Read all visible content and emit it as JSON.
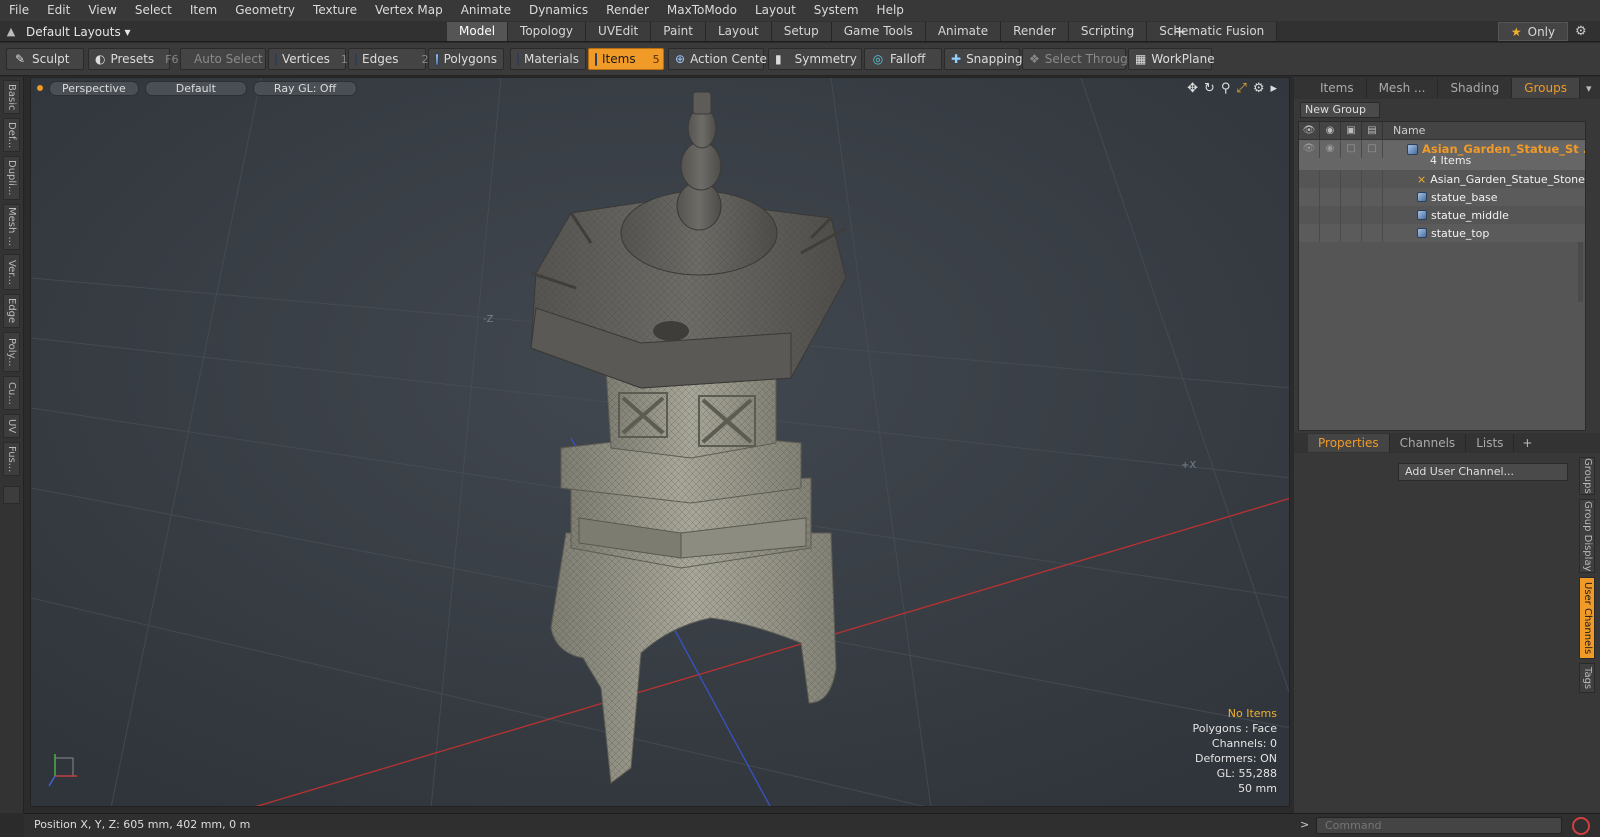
{
  "menu": [
    "File",
    "Edit",
    "View",
    "Select",
    "Item",
    "Geometry",
    "Texture",
    "Vertex Map",
    "Animate",
    "Dynamics",
    "Render",
    "MaxToModo",
    "Layout",
    "System",
    "Help"
  ],
  "layouts": {
    "label": "Default Layouts ▾"
  },
  "mode_tabs": [
    "Model",
    "Topology",
    "UVEdit",
    "Paint",
    "Layout",
    "Setup",
    "Game Tools",
    "Animate",
    "Render",
    "Scripting",
    "Schematic Fusion"
  ],
  "active_mode_tab": "Model",
  "only_label": "Only",
  "toolbar": {
    "sculpt": "Sculpt",
    "presets": "Presets",
    "presets_key": "F6",
    "auto_select": "Auto Select",
    "vertices": "Vertices",
    "vertices_key": "1",
    "edges": "Edges",
    "edges_key": "2",
    "polygons": "Polygons",
    "materials": "Materials",
    "items": "Items",
    "items_key": "5",
    "action_center": "Action Center",
    "symmetry": "Symmetry",
    "falloff": "Falloff",
    "snapping": "Snapping",
    "select_through": "Select Through",
    "workplane": "WorkPlane"
  },
  "left_tabs": [
    "Basic",
    "Def...",
    "Dupli...",
    "Mesh ...",
    "Ver...",
    "Edge",
    "Poly...",
    "Cu...",
    "UV",
    "Fus..."
  ],
  "viewport": {
    "view": "Perspective",
    "shading": "Default",
    "raygl": "Ray GL: Off",
    "info": {
      "no_items": "No Items",
      "polygons": "Polygons : Face",
      "channels": "Channels: 0",
      "deformers": "Deformers: ON",
      "gl": "GL: 55,288",
      "focal": "50 mm"
    }
  },
  "right_tabs": [
    "Items",
    "Mesh ...",
    "Shading",
    "Groups"
  ],
  "active_right_tab": "Groups",
  "groups": {
    "new_group": "New Group",
    "name_header": "Name",
    "group_name": "Asian_Garden_Statue_St ...",
    "group_count": "4 Items",
    "children": [
      "Asian_Garden_Statue_Stone",
      "statue_base",
      "statue_middle",
      "statue_top"
    ]
  },
  "prop_tabs": [
    "Properties",
    "Channels",
    "Lists"
  ],
  "active_prop_tab": "Properties",
  "add_user_channel": "Add User Channel...",
  "side_tabs": [
    "Groups",
    "Group Display",
    "User Channels",
    "Tags"
  ],
  "active_side_tab": "User Channels",
  "status": {
    "position": "Position X, Y, Z:  605 mm, 402 mm, 0 m"
  },
  "command": {
    "placeholder": "Command"
  },
  "colors": {
    "accent": "#f09a28",
    "viewport_bg": "#3a4047",
    "x_axis": "#c03030",
    "z_axis": "#3050c0"
  }
}
